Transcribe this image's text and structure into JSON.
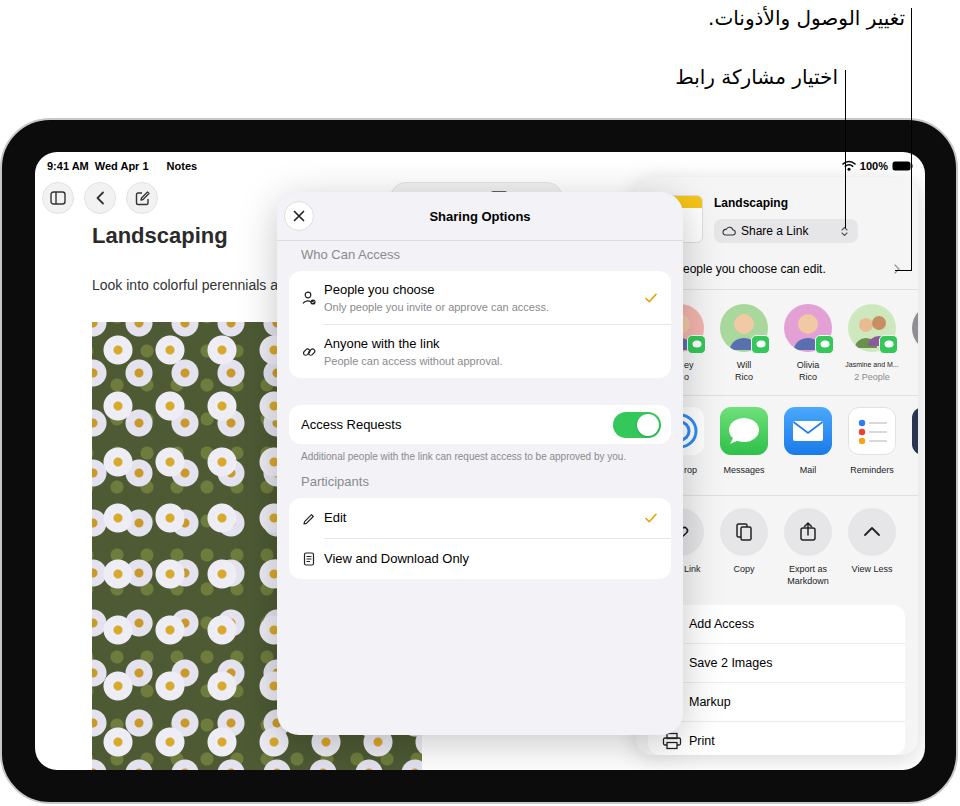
{
  "annotations": [
    {
      "text": "تغيير الوصول والأذونات."
    },
    {
      "text": "اختيار مشاركة رابط"
    }
  ],
  "status_bar": {
    "time": "9:41 AM",
    "date": "Wed Apr 1",
    "app": "Notes",
    "battery": "100%"
  },
  "note": {
    "title": "Landscaping",
    "body": "Look into colorful perennials a"
  },
  "share_sheet": {
    "title": "Landscaping",
    "share_mode": "Share a Link",
    "access_summary": "eople you choose can edit.",
    "people": [
      {
        "lines": [
          "ey",
          "o"
        ],
        "kind": "person",
        "clipped": true,
        "color": "#f3b4ae"
      },
      {
        "lines": [
          "Will",
          "Rico"
        ],
        "kind": "person",
        "clipped": false,
        "color": "#a8d89c"
      },
      {
        "lines": [
          "Olivia",
          "Rico"
        ],
        "kind": "person",
        "clipped": false,
        "color": "#e2a0d4"
      },
      {
        "lines": [
          "Jasmine and M...",
          "2 People"
        ],
        "kind": "group",
        "clipped": false,
        "color": "#cde8bd"
      }
    ],
    "apps": [
      {
        "label": "rop",
        "kind": "airdrop",
        "clipped": true
      },
      {
        "label": "Messages",
        "kind": "messages",
        "clipped": false
      },
      {
        "label": "Mail",
        "kind": "mail",
        "clipped": false
      },
      {
        "label": "Reminders",
        "kind": "reminders",
        "clipped": false
      }
    ],
    "actions": [
      {
        "lines": [
          "Link"
        ],
        "kind": "link",
        "clipped": true
      },
      {
        "lines": [
          "Copy"
        ],
        "kind": "copy",
        "clipped": false
      },
      {
        "lines": [
          "Export as",
          "Markdown"
        ],
        "kind": "export",
        "clipped": false
      },
      {
        "lines": [
          "View Less"
        ],
        "kind": "less",
        "clipped": false
      }
    ],
    "menu": [
      {
        "label": "Add Access",
        "kind": "access"
      },
      {
        "label": "Save 2 Images",
        "kind": "images"
      },
      {
        "label": "Markup",
        "kind": "markup"
      },
      {
        "label": "Print",
        "kind": "print"
      }
    ]
  },
  "modal": {
    "title": "Sharing Options",
    "access_header": "Who Can Access",
    "access_options": [
      {
        "title": "People you choose",
        "subtitle": "Only people you invite or approve can access.",
        "kind": "person",
        "selected": true
      },
      {
        "title": "Anyone with the link",
        "subtitle": "People can access without approval.",
        "kind": "link",
        "selected": false
      }
    ],
    "access_requests": {
      "label": "Access Requests",
      "on": true,
      "note": "Additional people with the link can request access to be approved by you."
    },
    "participants_header": "Participants",
    "permissions": [
      {
        "label": "Edit",
        "kind": "edit",
        "selected": true
      },
      {
        "label": "View and Download Only",
        "kind": "view",
        "selected": false
      }
    ]
  }
}
